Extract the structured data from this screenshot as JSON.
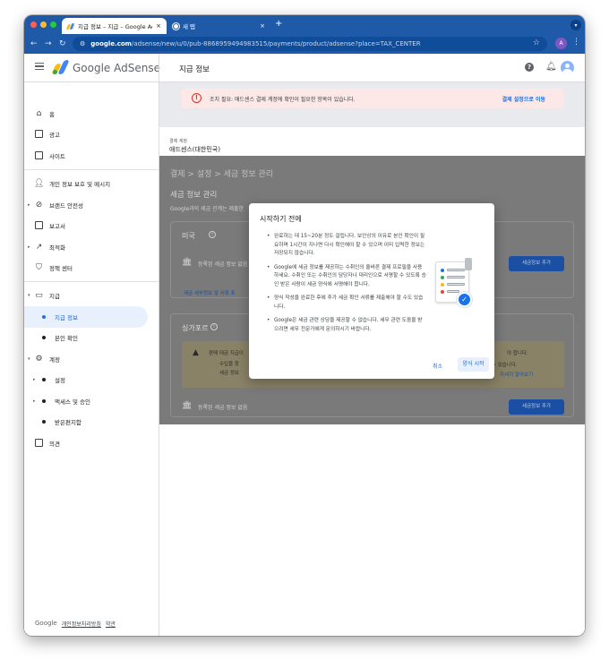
{
  "browser": {
    "tabs": [
      {
        "title": "지급 정보 – 지급 – Google AdSense",
        "close": "×"
      },
      {
        "title": "새 탭",
        "close": "×"
      }
    ],
    "new_tab": "+",
    "url_host": "google.com",
    "url_path": "/adsense/new/u/0/pub-8868959494983515/payments/product/adsense?place=TAX_CENTER",
    "profile_initial": "A"
  },
  "header": {
    "brand": "Google AdSense",
    "page_title": "지급 정보"
  },
  "sidebar": {
    "items": [
      {
        "label": "홈",
        "icon": "home-icon"
      },
      {
        "label": "광고",
        "icon": "ads-icon"
      },
      {
        "label": "사이트",
        "icon": "sites-icon"
      },
      {
        "label": "개인 정보 보호 및 메시지",
        "icon": "privacy-icon"
      },
      {
        "label": "브랜드 안전성",
        "icon": "block-icon"
      },
      {
        "label": "보고서",
        "icon": "reports-icon"
      },
      {
        "label": "최적화",
        "icon": "trending-icon"
      },
      {
        "label": "정책 센터",
        "icon": "policy-icon"
      },
      {
        "label": "지급",
        "icon": "payments-icon"
      },
      {
        "label": "지급 정보",
        "icon": "dot"
      },
      {
        "label": "본인 확인",
        "icon": "dot"
      },
      {
        "label": "계정",
        "icon": "gear-icon"
      },
      {
        "label": "설정",
        "icon": "dot"
      },
      {
        "label": "액세스 및 승인",
        "icon": "dot"
      },
      {
        "label": "받은편지함",
        "icon": "dot"
      },
      {
        "label": "의견",
        "icon": "feedback-icon"
      }
    ],
    "footer": {
      "google": "Google",
      "privacy": "개인정보처리방침",
      "terms": "약관"
    }
  },
  "banner": {
    "message": "조치 필요: 애드센스 결제 계정에 확인이 필요한 항목이 있습니다.",
    "action": "결제 설정으로 이동"
  },
  "account": {
    "label": "결제 계정",
    "value": "애드센스(대한민국)"
  },
  "background": {
    "breadcrumb": "결제  >  설정  >  세금 정보 관리",
    "section_title": "세금 정보 관리",
    "section_desc": "Google과의 세금 관계는 제출한",
    "us_card": {
      "title": "미국",
      "empty": "등록된 세금 정보 없음",
      "add_button": "세금정보 추가",
      "link": "세금 세부정보 및 서류 표"
    },
    "sg_card": {
      "title": "싱가포르",
      "warning": "판매 대금 지급이",
      "warning_right1": "야 합니다.",
      "bullet1": "수입을 창",
      "bullet2": "세금 정보",
      "warning_right2": "할 수 있습니다.",
      "learn_more": "자세히 알아보기",
      "empty": "등록된 세금 정보 없음",
      "add_button": "세금정보 추가"
    }
  },
  "dialog": {
    "title": "시작하기 전에",
    "bullets": [
      "완료하는 데 15~20분 정도 걸립니다. 보안상의 이유로 본인 확인이 필요하며 1시간이 지나면 다시 확인해야 할 수 있으며 이미 입력한 정보는 저장되지 않습니다.",
      "Google에 세금 정보를 제공하는 수취인의 올바른 결제 프로필을 사용하세요. 수취인 또는 수취인의 담당자나 대리인으로 서명할 수 있도록 승인 받은 사람이 세금 양식에 서명해야 합니다.",
      "양식 작성을 완료한 후에 추가 세금 확인 서류를 제출해야 할 수도 있습니다.",
      "Google은 세금 관련 상담을 제공할 수 없습니다. 세무 관련 도움을 받으려면 세무 전문가에게 문의하시기 바랍니다."
    ],
    "cancel": "취소",
    "start": "양식 시작"
  },
  "colors": {
    "accent": "#1a73e8",
    "browser_chrome": "#1e5aa8",
    "banner_bg": "#fce8e6",
    "error": "#d93025"
  }
}
